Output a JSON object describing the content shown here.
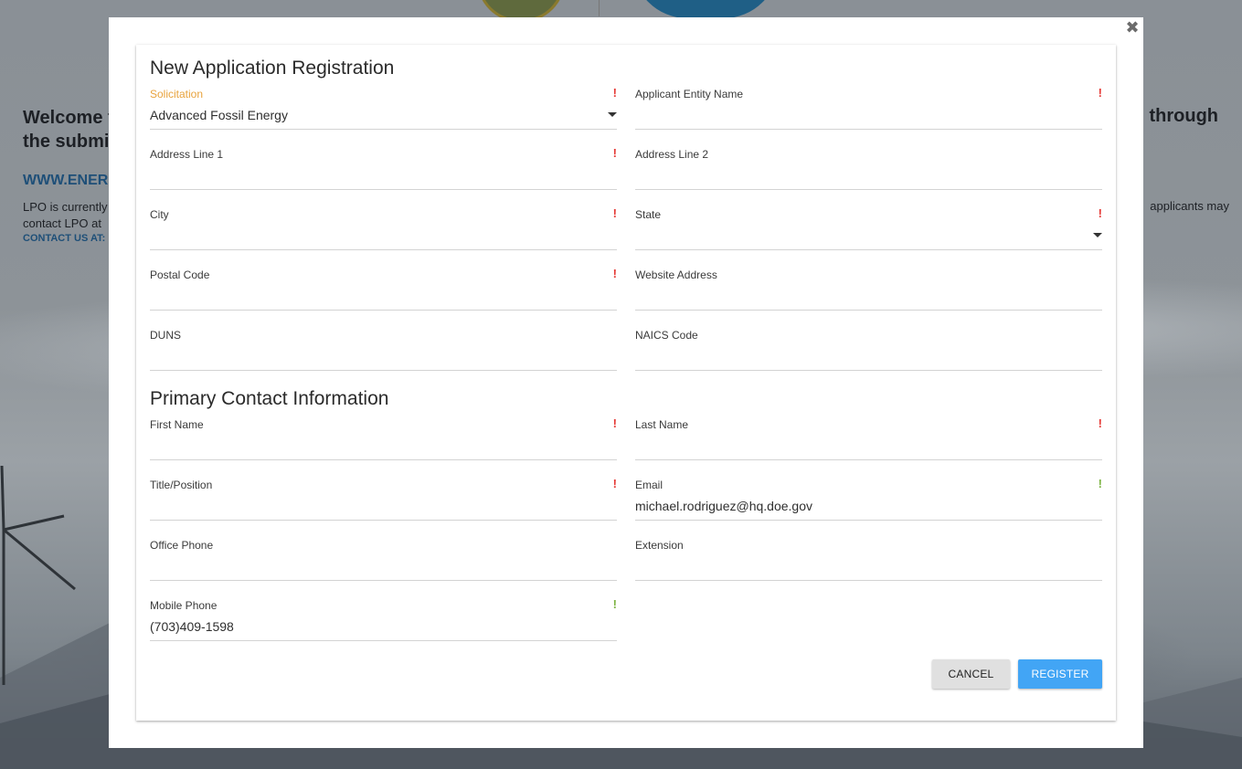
{
  "background": {
    "welcome_left": "Welcome t",
    "welcome_left_line2": "the submi",
    "welcome_right": "through",
    "link_text": "WWW.ENER",
    "body_left_line1": "LPO is currently",
    "body_left_line2": "contact LPO at",
    "body_right": "applicants may",
    "contact_label": "CONTACT US AT:"
  },
  "modal": {
    "close_glyph": "✖",
    "title": "New Application Registration",
    "contact_section_title": "Primary Contact Information",
    "fields": {
      "solicitation": {
        "label": "Solicitation",
        "value": "Advanced Fossil Energy",
        "required_mark": "!"
      },
      "applicant_entity_name": {
        "label": "Applicant Entity Name",
        "value": "",
        "required_mark": "!"
      },
      "address_line_1": {
        "label": "Address Line 1",
        "value": "",
        "required_mark": "!"
      },
      "address_line_2": {
        "label": "Address Line 2",
        "value": ""
      },
      "city": {
        "label": "City",
        "value": "",
        "required_mark": "!"
      },
      "state": {
        "label": "State",
        "value": "",
        "required_mark": "!"
      },
      "postal_code": {
        "label": "Postal Code",
        "value": "",
        "required_mark": "!"
      },
      "website_address": {
        "label": "Website Address",
        "value": ""
      },
      "duns": {
        "label": "DUNS",
        "value": ""
      },
      "naics_code": {
        "label": "NAICS Code",
        "value": ""
      },
      "first_name": {
        "label": "First Name",
        "value": "",
        "required_mark": "!"
      },
      "last_name": {
        "label": "Last Name",
        "value": "",
        "required_mark": "!"
      },
      "title_position": {
        "label": "Title/Position",
        "value": "",
        "required_mark": "!"
      },
      "email": {
        "label": "Email",
        "value": "michael.rodriguez@hq.doe.gov",
        "required_mark": "!"
      },
      "office_phone": {
        "label": "Office Phone",
        "value": ""
      },
      "extension": {
        "label": "Extension",
        "value": ""
      },
      "mobile_phone": {
        "label": "Mobile Phone",
        "value": "(703)409-1598",
        "required_mark": "!"
      }
    },
    "buttons": {
      "cancel": "CANCEL",
      "register": "REGISTER"
    }
  },
  "colors": {
    "required": "#e53935",
    "valid": "#7cb342",
    "focus_label": "#e8a33d",
    "primary_button": "#42a5f5"
  }
}
